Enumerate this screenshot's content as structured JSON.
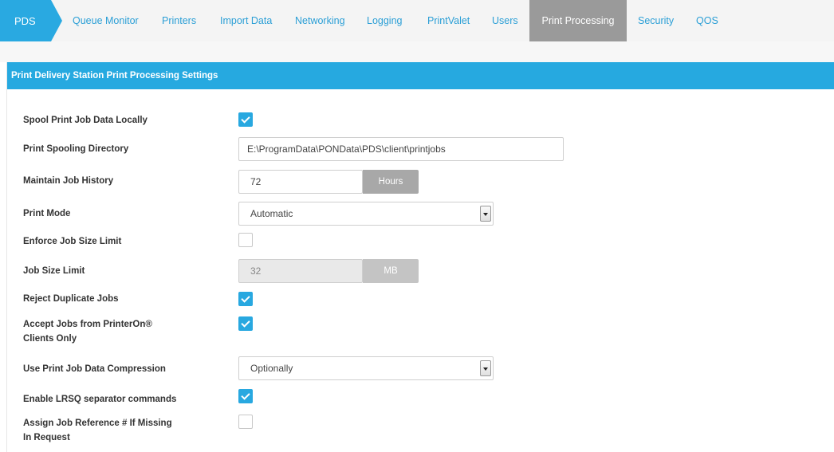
{
  "nav": {
    "home": "PDS",
    "tabs": [
      {
        "label": "Queue Monitor"
      },
      {
        "label": "Printers"
      },
      {
        "label": "Import Data"
      },
      {
        "label": "Networking"
      },
      {
        "label": "Logging"
      },
      {
        "label": "PrintValet"
      },
      {
        "label": "Users"
      },
      {
        "label": "Print Processing",
        "active": true
      },
      {
        "label": "Security"
      },
      {
        "label": "QOS"
      }
    ]
  },
  "panel": {
    "title": "Print Delivery Station Print Processing Settings"
  },
  "settings": {
    "spool_locally": {
      "label": "Spool Print Job Data Locally",
      "checked": true
    },
    "spool_dir": {
      "label": "Print Spooling Directory",
      "value": "E:\\ProgramData\\PONData\\PDS\\client\\printjobs"
    },
    "job_history": {
      "label": "Maintain Job History",
      "value": "72",
      "unit": "Hours"
    },
    "print_mode": {
      "label": "Print Mode",
      "value": "Automatic"
    },
    "enforce_size": {
      "label": "Enforce Job Size Limit",
      "checked": false
    },
    "size_limit": {
      "label": "Job Size Limit",
      "value": "32",
      "unit": "MB"
    },
    "reject_duplicates": {
      "label": "Reject Duplicate Jobs",
      "checked": true
    },
    "accept_printeron": {
      "label_line1": "Accept Jobs from PrinterOn®",
      "label_line2": "Clients Only",
      "checked": true
    },
    "compression": {
      "label": "Use Print Job Data Compression",
      "value": "Optionally"
    },
    "lrsq": {
      "label": "Enable LRSQ separator commands",
      "checked": true
    },
    "assign_ref": {
      "label_line1": "Assign Job Reference # If Missing",
      "label_line2": "In Request",
      "checked": false
    }
  },
  "colors": {
    "accent": "#26a9e0",
    "active_tab": "#9a9a9a"
  },
  "icons": {
    "checkbox_checked": "check-icon",
    "select_arrow": "chevron-down-icon"
  }
}
